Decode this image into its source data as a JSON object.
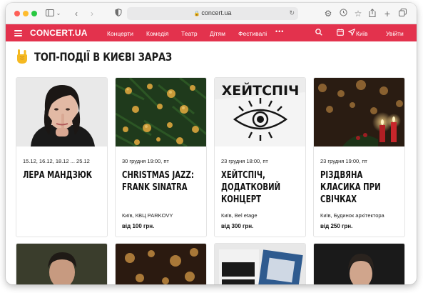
{
  "browser": {
    "url": "concert.ua"
  },
  "header": {
    "logo": "CONCERT.UA",
    "nav": [
      "Концерти",
      "Комедія",
      "Театр",
      "Дітям",
      "Фестивалі"
    ],
    "more": "•••",
    "city": "Київ",
    "login": "Увійти",
    "brand_color": "#e3324d"
  },
  "section": {
    "title": "ТОП-ПОДІЇ В КИЄВІ ЗАРАЗ"
  },
  "events": [
    {
      "date": "15.12, 16.12, 18.12 ... 25.12",
      "title": "ЛЕРА МАНДЗЮК",
      "venue": "",
      "price": ""
    },
    {
      "date": "30 грудня 19:00, пт",
      "title": "CHRISTMAS JAZZ: FRANK SINATRA",
      "venue": "Київ, КВЦ PARKOVY",
      "price": "від 100 грн."
    },
    {
      "date": "23 грудня 18:00, пт",
      "title": "ХЕЙТСПІЧ, ДОДАТКОВИЙ КОНЦЕРТ",
      "venue": "Київ, Bel etage",
      "price": "від 300 грн."
    },
    {
      "date": "23 грудня 19:00, пт",
      "title": "РІЗДВЯНА КЛАСИКА ПРИ СВІЧКАХ",
      "venue": "Київ, Будинок архітектора",
      "price": "від 250 грн."
    }
  ],
  "poster": {
    "heitspich_text": "ХЕЙТСПІЧ"
  }
}
